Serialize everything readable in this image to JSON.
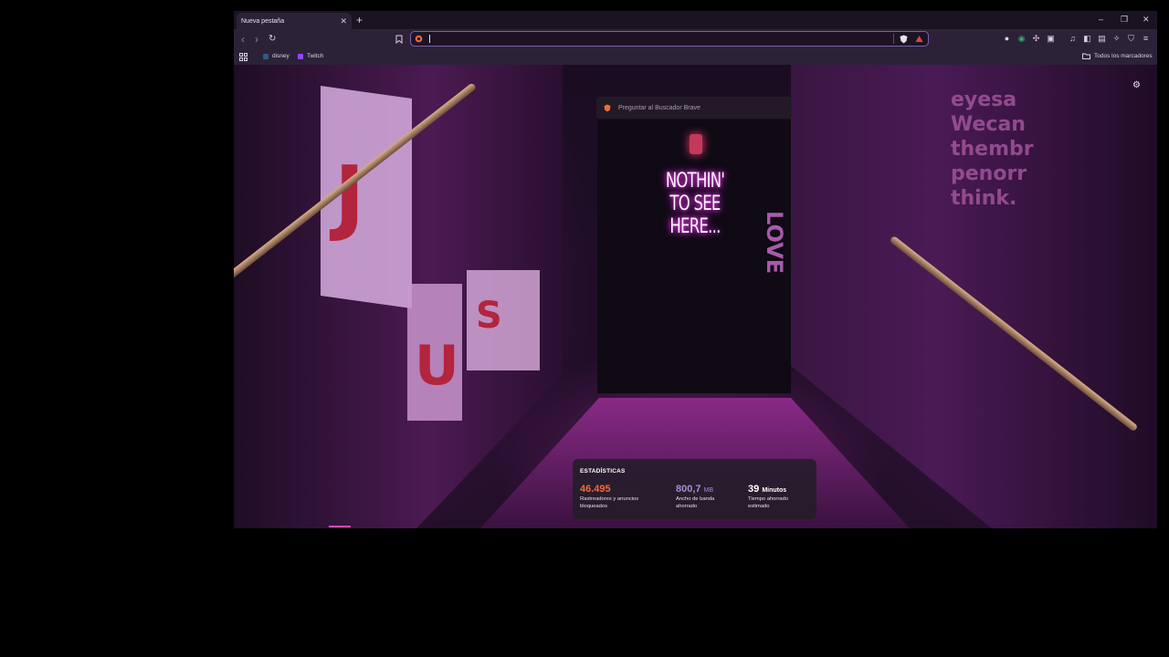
{
  "browser": {
    "tab": {
      "title": "Nueva pestaña",
      "close": "✕"
    },
    "new_tab": "+",
    "window_controls": {
      "minimize": "–",
      "restore": "❐",
      "close": "✕"
    },
    "nav": {
      "back": "‹",
      "forward": "›",
      "reload": "↻"
    },
    "url_value": "",
    "bookmarks": [
      {
        "label": "disney",
        "icon": "disney-icon"
      },
      {
        "label": "Twitch",
        "icon": "twitch-icon"
      }
    ],
    "all_bookmarks": "Todos los marcadores"
  },
  "newtab": {
    "search_placeholder": "Preguntar al Buscador Brave",
    "wallpaper_sign": "NOTHIN' TO SEE HERE...",
    "stats": {
      "title": "ESTADÍSTICAS",
      "items": [
        {
          "value": "46.495",
          "unit": "",
          "label": "Rastreadores y anuncios bloqueados",
          "color": "#f26b3a"
        },
        {
          "value": "800,7",
          "unit": "MB",
          "label": "Ancho de banda ahorrado",
          "color": "#a98bd9"
        },
        {
          "value": "39",
          "unit": "Minutos",
          "label": "Tiempo ahorrado estimado",
          "color": "#ffffff"
        }
      ]
    }
  },
  "colors": {
    "accent": "#7a5fb0",
    "toolbar": "#2c2238",
    "brave_orange": "#f26b3a"
  }
}
